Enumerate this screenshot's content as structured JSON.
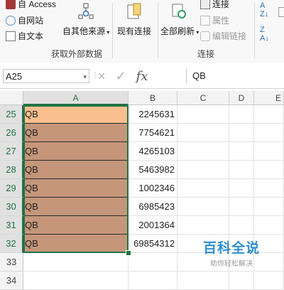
{
  "ribbon": {
    "from_access": "自 Access",
    "from_web": "自网站",
    "from_text": "自文本",
    "from_other": "自其他来源",
    "existing_connections": "现有连接",
    "refresh_all": "全部刷新",
    "connections": "连接",
    "properties": "属性",
    "edit_links": "编辑链接",
    "group_get_external": "获取外部数据",
    "group_connections": "连接"
  },
  "formula_bar": {
    "name_box": "A25",
    "cancel_icon": "×",
    "enter_icon": "✓",
    "fx": "fx",
    "value": "QB"
  },
  "columns": [
    "A",
    "B",
    "C",
    "D",
    "E"
  ],
  "rows": [
    {
      "num": "25",
      "a": "QB",
      "b": "2245631"
    },
    {
      "num": "26",
      "a": "QB",
      "b": "7754621"
    },
    {
      "num": "27",
      "a": "QB",
      "b": "4265103"
    },
    {
      "num": "28",
      "a": "QB",
      "b": "5463982"
    },
    {
      "num": "29",
      "a": "QB",
      "b": "1002346"
    },
    {
      "num": "30",
      "a": "QB",
      "b": "6985423"
    },
    {
      "num": "31",
      "a": "QB",
      "b": "2001364"
    },
    {
      "num": "32",
      "a": "QB",
      "b": "69854312"
    },
    {
      "num": "33",
      "a": "",
      "b": ""
    },
    {
      "num": "34",
      "a": "",
      "b": ""
    }
  ],
  "watermark": {
    "title": "百科全说",
    "subtitle": "助你轻松解决"
  },
  "colors": {
    "accent": "#217346",
    "fill_first": "#f9bf8f",
    "fill_rest": "#c5967a"
  }
}
